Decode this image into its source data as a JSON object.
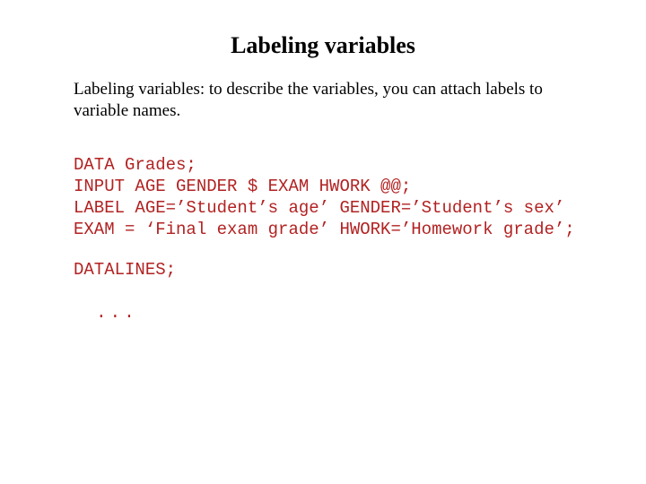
{
  "title": "Labeling variables",
  "description": "Labeling variables: to describe the variables, you can attach labels to variable names.",
  "code": {
    "l1": "DATA Grades;",
    "l2": "INPUT AGE GENDER $ EXAM HWORK @@;",
    "l3": "LABEL AGE=’Student’s age’ GENDER=’Student’s sex’",
    "l4": "EXAM = ‘Final exam grade’ HWORK=’Homework grade’;",
    "l5": "DATALINES;",
    "l6": "..."
  }
}
